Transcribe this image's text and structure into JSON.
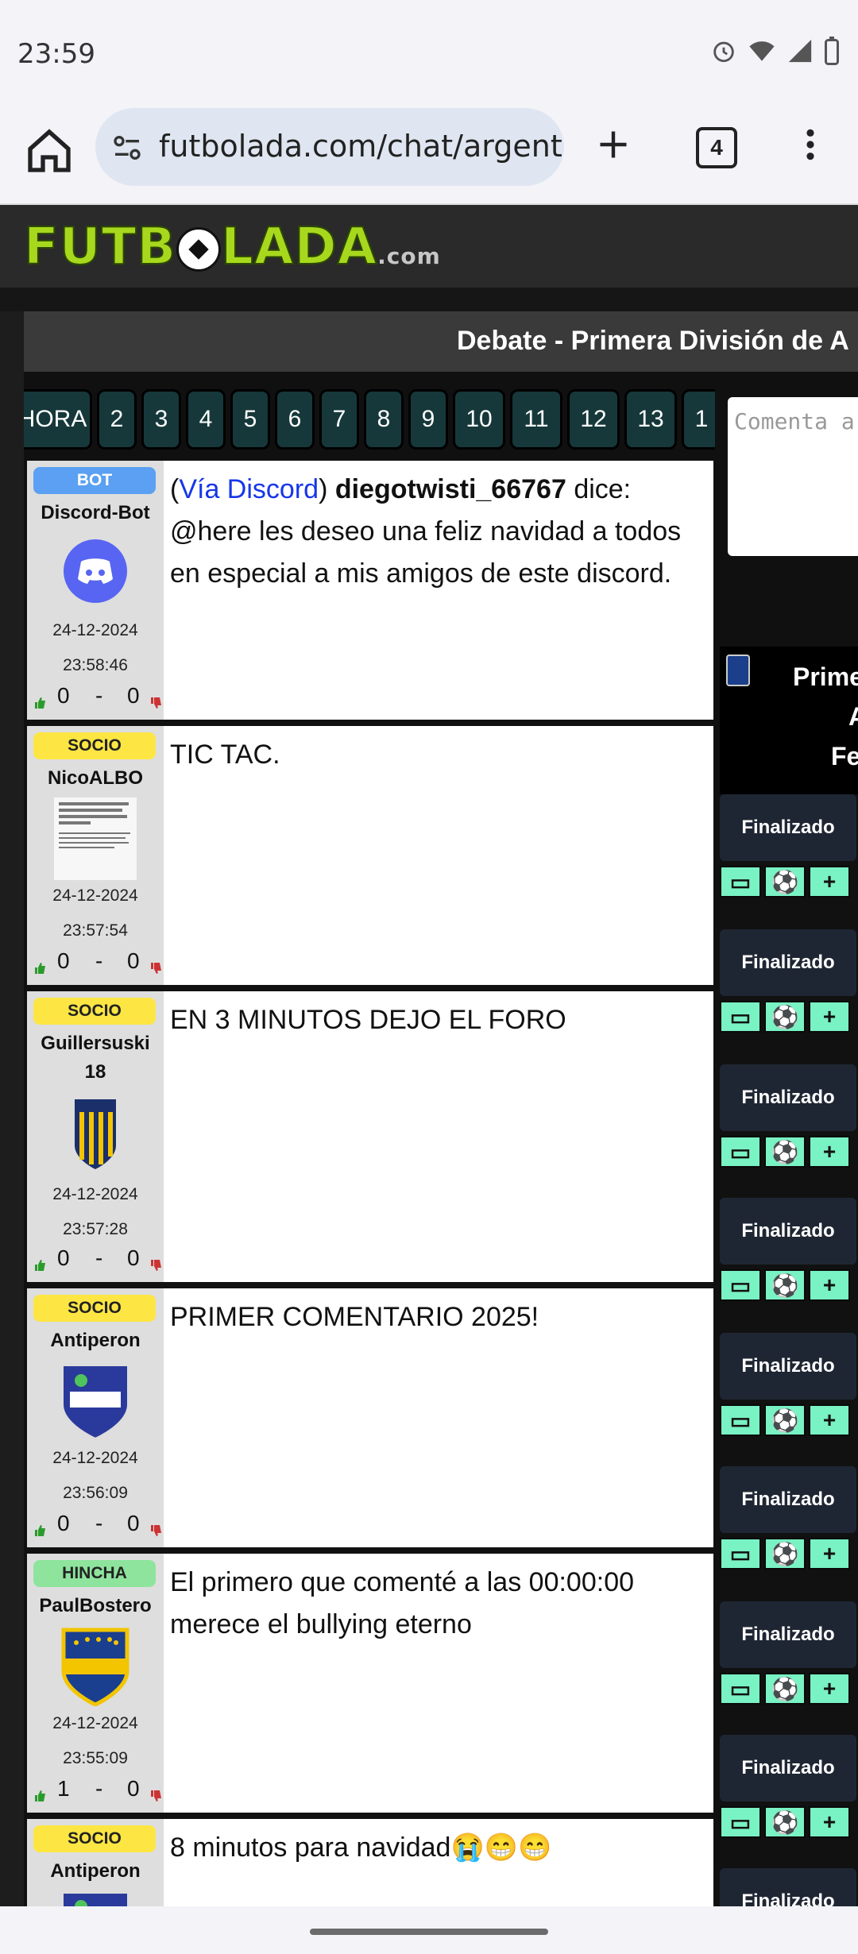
{
  "status_bar": {
    "time": "23:59"
  },
  "browser": {
    "url": "futbolada.com/chat/argenti",
    "tab_count": "4"
  },
  "site": {
    "logo_main": "FUTB",
    "logo_rest": "LADA",
    "logo_com": ".com",
    "title": "Debate - Primera División de A",
    "pages": [
      "HORA",
      "2",
      "3",
      "4",
      "5",
      "6",
      "7",
      "8",
      "9",
      "10",
      "11",
      "12",
      "13",
      "1"
    ],
    "comment_placeholder": "Comenta a"
  },
  "posts": [
    {
      "role": "BOT",
      "user": "Discord-Bot",
      "date": "24-12-2024",
      "time": "23:58:46",
      "up": "0",
      "down": "0",
      "via": "Vía Discord",
      "author": "diegotwisti_66767",
      "dice": "dice:",
      "text": "@here les deseo una feliz navidad a todos en especial a mis amigos de este discord."
    },
    {
      "role": "SOCIO",
      "user": "NicoALBO",
      "date": "24-12-2024",
      "time": "23:57:54",
      "up": "0",
      "down": "0",
      "text": "TIC TAC."
    },
    {
      "role": "SOCIO",
      "user": "Guillersuski 18",
      "date": "24-12-2024",
      "time": "23:57:28",
      "up": "0",
      "down": "0",
      "text": "EN 3 MINUTOS DEJO EL FORO"
    },
    {
      "role": "SOCIO",
      "user": "Antiperon",
      "date": "24-12-2024",
      "time": "23:56:09",
      "up": "0",
      "down": "0",
      "text": "PRIMER COMENTARIO 2025!"
    },
    {
      "role": "HINCHA",
      "user": "PaulBostero",
      "date": "24-12-2024",
      "time": "23:55:09",
      "up": "1",
      "down": "0",
      "text": "El primero que comenté a las 00:00:00 merece el bullying eterno"
    },
    {
      "role": "SOCIO",
      "user": "Antiperon",
      "text": "8 minutos para navidad😭😁😁"
    }
  ],
  "right": {
    "head_line1": "Prime",
    "head_line2": "A",
    "head_line3": "Fe",
    "match_status": "Finalizado",
    "btn_plus": "+"
  }
}
